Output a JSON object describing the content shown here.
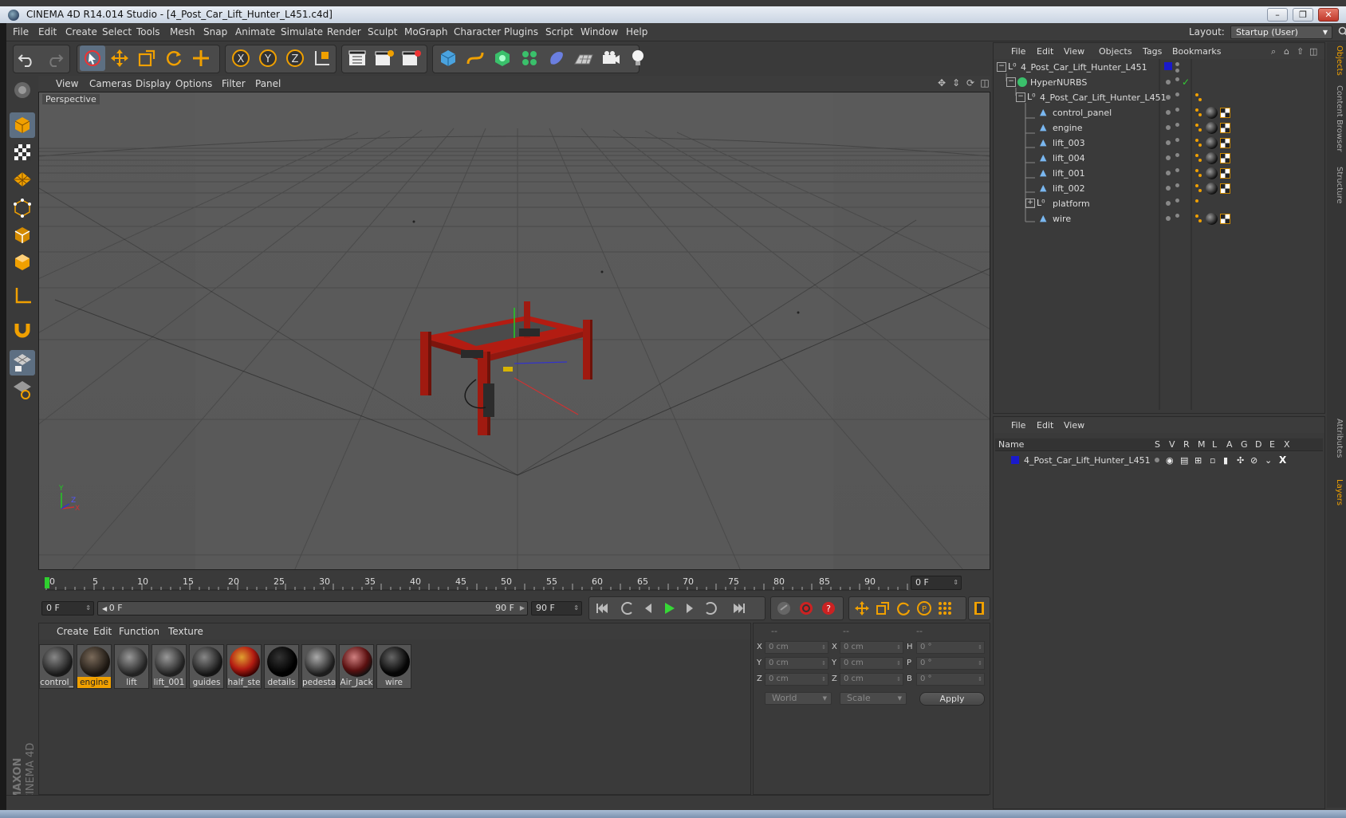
{
  "window": {
    "title": "CINEMA 4D R14.014 Studio - [4_Post_Car_Lift_Hunter_L451.c4d]",
    "controls": [
      "–",
      "❐",
      "✕"
    ]
  },
  "menubar": {
    "items": [
      "File",
      "Edit",
      "Create",
      "Select",
      "Tools",
      "Mesh",
      "Snap",
      "Animate",
      "Simulate",
      "Render",
      "Sculpt",
      "MoGraph",
      "Character",
      "Plugins",
      "Script",
      "Window",
      "Help"
    ],
    "layout_label": "Layout:",
    "layout_value": "Startup (User)"
  },
  "toolbar": {
    "icons": [
      "undo-icon",
      "redo-icon",
      "live-selection-icon",
      "move-icon",
      "scale-icon",
      "rotate-icon",
      "add-object-icon",
      "x-axis-icon",
      "y-axis-icon",
      "z-axis-icon",
      "coordinate-system-icon",
      "render-view-icon",
      "render-picture-viewer-icon",
      "render-settings-icon",
      "cube-primitive-icon",
      "spline-icon",
      "nurbs-icon",
      "mograph-cloner-icon",
      "deformer-icon",
      "floor-icon",
      "camera-icon",
      "light-icon"
    ],
    "axis_labels": [
      "X",
      "Y",
      "Z"
    ]
  },
  "left_toolbar": {
    "icons": [
      "make-editable-icon",
      "model-mode-icon",
      "texture-mode-icon",
      "workplane-mode-icon",
      "points-mode-icon",
      "edges-mode-icon",
      "polygons-mode-icon",
      "axis-mode-icon",
      "snap-icon",
      "workplane-lock-icon",
      "quantize-icon"
    ],
    "brand_top": "MAXON",
    "brand_bottom": "CINEMA 4D"
  },
  "viewport": {
    "menu": [
      "View",
      "Cameras",
      "Display",
      "Options",
      "Filter",
      "Panel"
    ],
    "label": "Perspective",
    "axis_labels": {
      "y": "Y",
      "x": "X",
      "z": "Z"
    }
  },
  "timeline": {
    "ticks": [
      "0",
      "5",
      "10",
      "15",
      "20",
      "25",
      "30",
      "35",
      "40",
      "45",
      "50",
      "55",
      "60",
      "65",
      "70",
      "75",
      "80",
      "85",
      "90"
    ],
    "current_frame": "0 F",
    "start_frame": "0 F",
    "range_start": "0 F",
    "range_end": "90 F",
    "end_frame": "90 F"
  },
  "materials": {
    "menu": [
      "Create",
      "Edit",
      "Function",
      "Texture"
    ],
    "items": [
      {
        "name": "control_",
        "selected": false
      },
      {
        "name": "engine",
        "selected": true
      },
      {
        "name": "lift",
        "selected": false
      },
      {
        "name": "lift_001",
        "selected": false
      },
      {
        "name": "guides",
        "selected": false
      },
      {
        "name": "half_ste",
        "selected": false
      },
      {
        "name": "details",
        "selected": false
      },
      {
        "name": "pedesta",
        "selected": false
      },
      {
        "name": "Air_Jack",
        "selected": false
      },
      {
        "name": "wire",
        "selected": false
      }
    ]
  },
  "coordinates": {
    "headers": [
      "--",
      "--",
      "--"
    ],
    "rows": [
      {
        "l1": "X",
        "v1": "0 cm",
        "l2": "X",
        "v2": "0 cm",
        "l3": "H",
        "v3": "0 °"
      },
      {
        "l1": "Y",
        "v1": "0 cm",
        "l2": "Y",
        "v2": "0 cm",
        "l3": "P",
        "v3": "0 °"
      },
      {
        "l1": "Z",
        "v1": "0 cm",
        "l2": "Z",
        "v2": "0 cm",
        "l3": "B",
        "v3": "0 °"
      }
    ],
    "mode": "World",
    "transform": "Scale",
    "apply": "Apply"
  },
  "objects": {
    "menu": [
      "File",
      "Edit",
      "View",
      "Objects",
      "Tags",
      "Bookmarks"
    ],
    "tree": [
      {
        "name": "4_Post_Car_Lift_Hunter_L451",
        "type": "null"
      },
      {
        "name": "HyperNURBS",
        "type": "nurbs"
      },
      {
        "name": "4_Post_Car_Lift_Hunter_L451",
        "type": "null"
      },
      {
        "name": "control_panel",
        "type": "poly"
      },
      {
        "name": "engine",
        "type": "poly"
      },
      {
        "name": "lift_003",
        "type": "poly"
      },
      {
        "name": "lift_004",
        "type": "poly"
      },
      {
        "name": "lift_001",
        "type": "poly"
      },
      {
        "name": "lift_002",
        "type": "poly"
      },
      {
        "name": "platform",
        "type": "null"
      },
      {
        "name": "wire",
        "type": "poly"
      }
    ]
  },
  "layers": {
    "menu": [
      "File",
      "Edit",
      "View"
    ],
    "columns": [
      "Name",
      "S",
      "V",
      "R",
      "M",
      "L",
      "A",
      "G",
      "D",
      "E",
      "X"
    ],
    "rows": [
      {
        "name": "4_Post_Car_Lift_Hunter_L451",
        "color": "#1a1acc"
      }
    ]
  },
  "side_tabs": [
    "Objects",
    "Content Browser",
    "Structure",
    "Attributes",
    "Layers"
  ],
  "colors": {
    "accent": "#f0a000",
    "selection_blue": "#5d6f82",
    "lift_red": "#b31c12"
  }
}
